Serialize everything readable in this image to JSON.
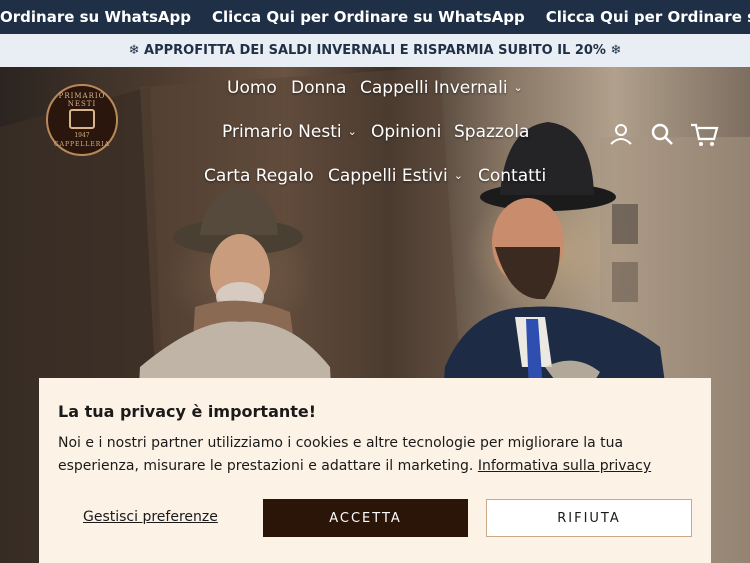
{
  "ticker": {
    "items": [
      "Ordinare su WhatsApp",
      "Clicca Qui per Ordinare su WhatsApp",
      "Clicca Qui per Ordinare su WhatsA"
    ]
  },
  "promo": {
    "text": "❄ APPROFITTA DEI SALDI INVERNALI E RISPARMIA SUBITO IL 20% ❄"
  },
  "logo": {
    "top": "PRIMARIO NESTI",
    "year": "1947",
    "bottom": "CAPPELLERIA"
  },
  "nav": {
    "uomo": "Uomo",
    "donna": "Donna",
    "cappelli_invernali": "Cappelli Invernali",
    "primario_nesti": "Primario Nesti",
    "opinioni": "Opinioni",
    "spazzola": "Spazzola",
    "carta_regalo": "Carta Regalo",
    "cappelli_estivi": "Cappelli Estivi",
    "contatti": "Contatti"
  },
  "icons": {
    "account": "user-icon",
    "search": "search-icon",
    "cart": "cart-icon",
    "dropdown": "chevron-down-icon"
  },
  "cookie": {
    "title": "La tua privacy è importante!",
    "text": "Noi e i nostri partner utilizziamo i cookies e altre tecnologie per migliorare la tua esperienza, misurare le prestazioni e adattare il marketing.",
    "link": "Informativa sulla privacy",
    "prefs": "Gestisci preferenze",
    "accept": "ACCETTA",
    "reject": "RIFIUTA"
  },
  "colors": {
    "ticker_bg": "#1f2f45",
    "promo_bg": "#e8eef4",
    "accent": "#2b1508",
    "cookie_bg": "#fdf2e6"
  }
}
